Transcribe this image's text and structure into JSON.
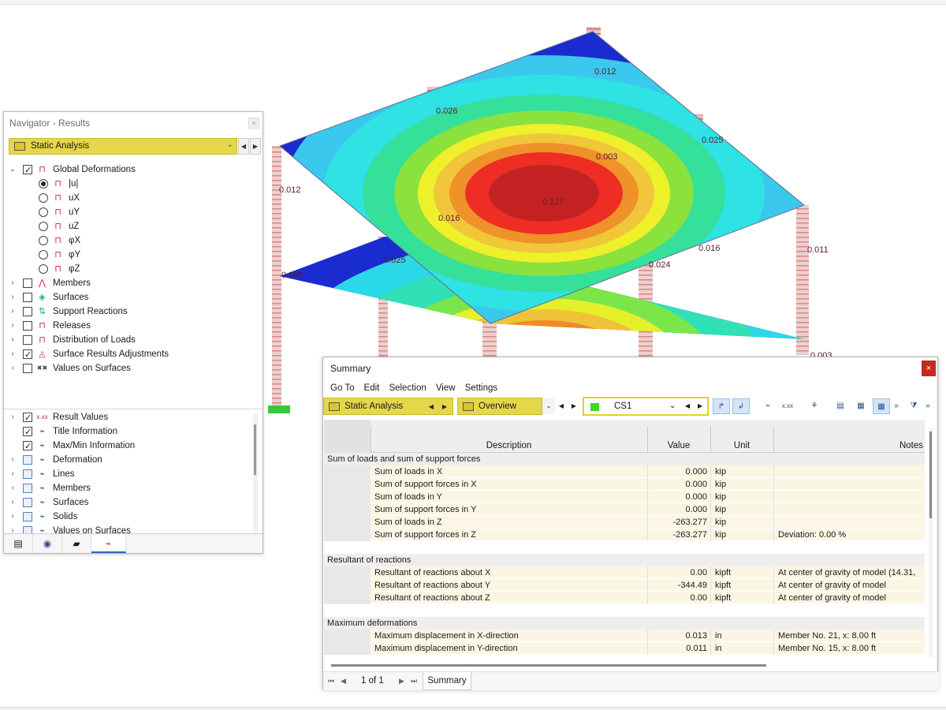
{
  "viewport": {
    "labels": [
      "0.012",
      "0.026",
      "0.025",
      "0.003",
      "0.127",
      "0.016",
      "0.012",
      "0.003",
      "0.025",
      "0.024",
      "0.016",
      "0.011",
      "0.003"
    ]
  },
  "navigator": {
    "title": "Navigator - Results",
    "close": "×",
    "combo": "Static Analysis",
    "tree": [
      {
        "label": "Global Deformations",
        "checked": true,
        "expanded": true
      },
      {
        "label": "|u|",
        "radio": true,
        "selected": true
      },
      {
        "label": "uX",
        "radio": true
      },
      {
        "label": "uY",
        "radio": true
      },
      {
        "label": "uZ",
        "radio": true
      },
      {
        "label": "φX",
        "radio": true
      },
      {
        "label": "φY",
        "radio": true
      },
      {
        "label": "φZ",
        "radio": true
      },
      {
        "label": "Members",
        "checked": false
      },
      {
        "label": "Surfaces",
        "checked": false
      },
      {
        "label": "Support Reactions",
        "checked": false
      },
      {
        "label": "Releases",
        "checked": false
      },
      {
        "label": "Distribution of Loads",
        "checked": false
      },
      {
        "label": "Surface Results Adjustments",
        "checked": true
      },
      {
        "label": "Values on Surfaces",
        "checked": false
      }
    ],
    "tree2": [
      {
        "label": "Result Values",
        "checked": true
      },
      {
        "label": "Title Information",
        "checked": true
      },
      {
        "label": "Max/Min Information",
        "checked": true
      },
      {
        "label": "Deformation",
        "checked": false
      },
      {
        "label": "Lines",
        "checked": false
      },
      {
        "label": "Members",
        "checked": false
      },
      {
        "label": "Surfaces",
        "checked": false
      },
      {
        "label": "Solids",
        "checked": false
      },
      {
        "label": "Values on Surfaces",
        "checked": false
      }
    ]
  },
  "summary": {
    "title": "Summary",
    "close": "×",
    "menu": [
      "Go To",
      "Edit",
      "Selection",
      "View",
      "Settings"
    ],
    "analysis": "Static Analysis",
    "overview": "Overview",
    "loadcase": "CS1",
    "columns": {
      "description": "Description",
      "value": "Value",
      "unit": "Unit",
      "notes": "Notes"
    },
    "groups": [
      {
        "title": "Sum of loads and sum of support forces",
        "rows": [
          {
            "d": "Sum of loads in X",
            "v": "0.000",
            "u": "kip",
            "n": ""
          },
          {
            "d": "Sum of support forces in X",
            "v": "0.000",
            "u": "kip",
            "n": ""
          },
          {
            "d": "Sum of loads in Y",
            "v": "0.000",
            "u": "kip",
            "n": ""
          },
          {
            "d": "Sum of support forces in Y",
            "v": "0.000",
            "u": "kip",
            "n": ""
          },
          {
            "d": "Sum of loads in Z",
            "v": "-263.277",
            "u": "kip",
            "n": ""
          },
          {
            "d": "Sum of support forces in Z",
            "v": "-263.277",
            "u": "kip",
            "n": "Deviation: 0.00 %"
          }
        ]
      },
      {
        "title": "Resultant of reactions",
        "rows": [
          {
            "d": "Resultant of reactions about X",
            "v": "0.00",
            "u": "kipft",
            "n": "At center of gravity of model (14.31,"
          },
          {
            "d": "Resultant of reactions about Y",
            "v": "-344.49",
            "u": "kipft",
            "n": "At center of gravity of model"
          },
          {
            "d": "Resultant of reactions about Z",
            "v": "0.00",
            "u": "kipft",
            "n": "At center of gravity of model"
          }
        ]
      },
      {
        "title": "Maximum deformations",
        "rows": [
          {
            "d": "Maximum displacement in X-direction",
            "v": "0.013",
            "u": "in",
            "n": "Member No. 21, x: 8.00 ft"
          },
          {
            "d": "Maximum displacement in Y-direction",
            "v": "0.011",
            "u": "in",
            "n": "Member No. 15, x: 8.00 ft"
          }
        ]
      }
    ],
    "pager": {
      "text": "1 of 1",
      "tab": "Summary"
    }
  }
}
